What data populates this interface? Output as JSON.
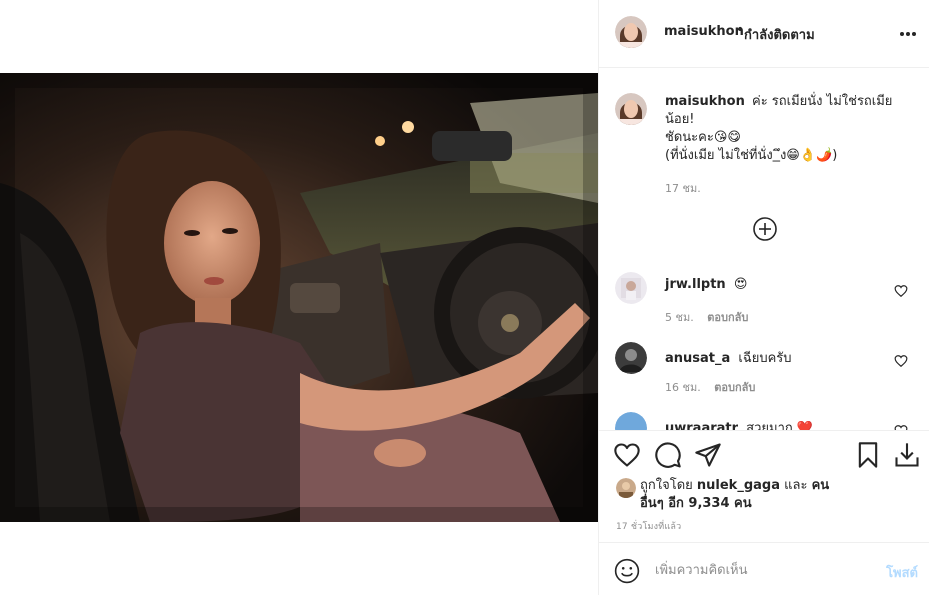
{
  "post": {
    "username": "maisukhon",
    "header_separator": "•",
    "follow_status": "กำลังติดตาม",
    "caption_line1": "ค่ะ รถเมียนั่ง ไม่ใช่รถเมียน้อย!",
    "caption_line2": "ชัดนะคะ😘😋",
    "caption_line3": "(ที่นั่งเมีย ไม่ใช่ที่นั่ง_ึง😁👌🌶️)",
    "caption_time": "17 ชม."
  },
  "comments": [
    {
      "username": "jrw.llptn",
      "text": "😍",
      "time": "5 ชม.",
      "reply_label": "ตอบกลับ"
    },
    {
      "username": "anusat_a",
      "text": "เฉียบครับ",
      "time": "16 ชม.",
      "reply_label": "ตอบกลับ"
    },
    {
      "username": "uwraaratr",
      "text": "สวยมาก ❤️",
      "time": "",
      "reply_label": ""
    }
  ],
  "likes": {
    "prefix": "ถูกใจโดย",
    "first_liker": "nulek_gaga",
    "conj": "และ",
    "others": "คนอื่นๆ อีก 9,334 คน"
  },
  "post_time": "17 ชั่วโมงที่แล้ว",
  "add_comment": {
    "placeholder": "เพิ่มความคิดเห็น",
    "post_label": "โพสต์"
  },
  "icons": {
    "more": "more-options-icon",
    "add_comments": "plus-circle-icon",
    "like": "heart-icon",
    "comment": "comment-bubble-icon",
    "share": "paper-plane-icon",
    "save": "bookmark-icon",
    "download": "download-icon",
    "emoji": "emoji-smiley-icon"
  },
  "colors": {
    "text": "#262626",
    "secondary": "#8e8e8e",
    "border": "#efefef",
    "post_disabled": "#b3dbff"
  }
}
